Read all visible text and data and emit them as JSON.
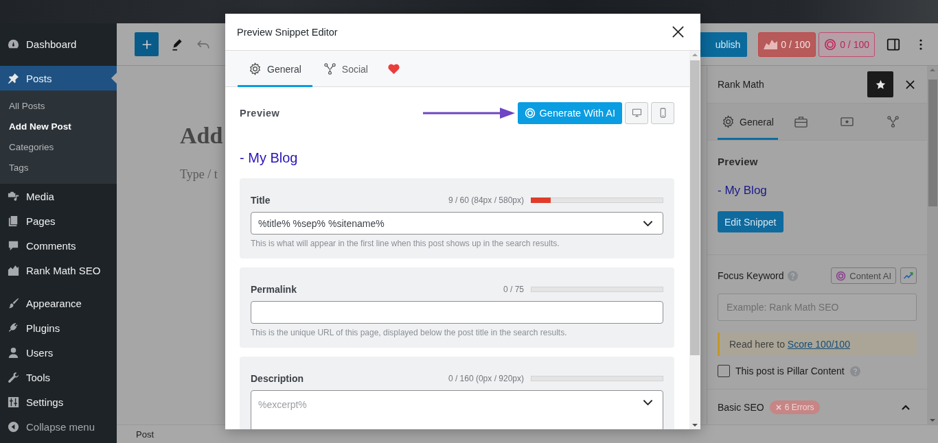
{
  "admin_menu": {
    "items": [
      {
        "label": "Dashboard",
        "selected": false
      },
      {
        "label": "Posts",
        "selected": true,
        "children": [
          {
            "label": "All Posts",
            "selected": false
          },
          {
            "label": "Add New Post",
            "selected": true
          },
          {
            "label": "Categories",
            "selected": false
          },
          {
            "label": "Tags",
            "selected": false
          }
        ]
      },
      {
        "label": "Media",
        "selected": false
      },
      {
        "label": "Pages",
        "selected": false
      },
      {
        "label": "Comments",
        "selected": false
      },
      {
        "label": "Rank Math SEO",
        "selected": false
      },
      {
        "label": "Appearance",
        "selected": false
      },
      {
        "label": "Plugins",
        "selected": false
      },
      {
        "label": "Users",
        "selected": false
      },
      {
        "label": "Tools",
        "selected": false
      },
      {
        "label": "Settings",
        "selected": false
      }
    ],
    "collapse_label": "Collapse menu"
  },
  "editor_toolbar": {
    "publish_label": "ublish",
    "seo_score": "0 / 100",
    "content_ai_score": "0 / 100"
  },
  "editor": {
    "title": "Add",
    "block_hint": "Type / t"
  },
  "rank_math_sidebar": {
    "title": "Rank Math",
    "tabs": [
      {
        "label": "General",
        "selected": true
      },
      {
        "selected": false
      },
      {
        "selected": false
      },
      {
        "selected": false
      }
    ],
    "preview_label": "Preview",
    "preview_title": "- My Blog",
    "edit_snippet_label": "Edit Snippet",
    "focus_keyword_label": "Focus Keyword",
    "content_ai_label": "Content AI",
    "keyword_placeholder": "Example: Rank Math SEO",
    "notice": {
      "text": "Read here to",
      "link": "Score 100/100"
    },
    "pillar_content": {
      "label": "This post is Pillar Content",
      "checked": false
    },
    "basic_seo": {
      "label": "Basic SEO",
      "badge": "6 Errors",
      "expanded": true
    }
  },
  "status_bar": {
    "breadcrumb": "Post"
  },
  "modal": {
    "title": "Preview Snippet Editor",
    "tabs": [
      {
        "label": "General",
        "selected": true
      },
      {
        "label": "Social",
        "selected": false
      },
      {
        "selected": false
      }
    ],
    "preview_label": "Preview",
    "generate_label": "Generate With AI",
    "preview_title": "- My Blog",
    "fields": [
      {
        "kind": "variable-select",
        "label": "Title",
        "counter": "9 / 60 (84px / 580px)",
        "level": 0.15,
        "value": "%title% %sep% %sitename%",
        "help": "This is what will appear in the first line when this post shows up in the search results."
      },
      {
        "kind": "text",
        "label": "Permalink",
        "counter": "0 / 75",
        "help": "This is the unique URL of this page, displayed below the post title in the search results."
      },
      {
        "kind": "variable-textarea",
        "label": "Description",
        "counter": "0 / 160 (0px / 920px)",
        "placeholder": "%excerpt%"
      }
    ]
  }
}
